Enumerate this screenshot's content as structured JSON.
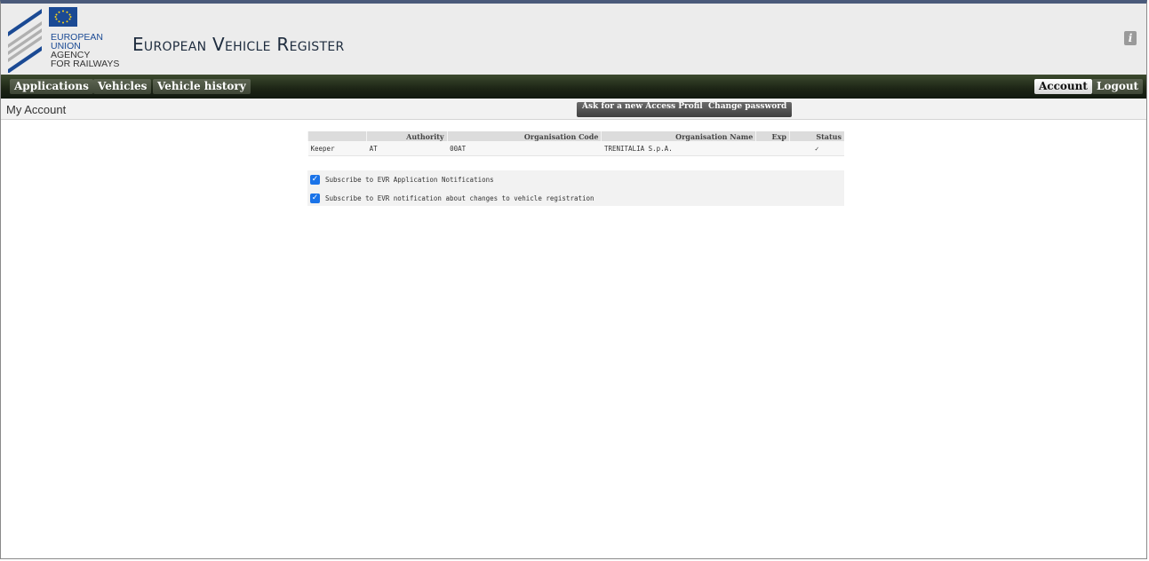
{
  "header": {
    "agency_lines": [
      "EUROPEAN",
      "UNION",
      "AGENCY",
      "FOR RAILWAYS"
    ],
    "app_title": "European Vehicle Register",
    "info_icon": "info-icon"
  },
  "nav": {
    "left": [
      "Applications",
      "Vehicles",
      "Vehicle history"
    ],
    "account": "Account",
    "logout": "Logout"
  },
  "page": {
    "title": "My Account",
    "ask_profile": "Ask for a new Access Profile",
    "change_password": "Change password"
  },
  "table": {
    "headers": [
      "",
      "Authority",
      "Organisation Code",
      "Organisation Name",
      "Exp",
      "Status"
    ],
    "rows": [
      [
        "Keeper",
        "AT",
        "00AT",
        "TRENITALIA S.p.A.",
        "",
        "✓"
      ]
    ]
  },
  "subscriptions": [
    {
      "label": "Subscribe to EVR Application Notifications",
      "checked": true
    },
    {
      "label": "Subscribe to EVR notification about changes to vehicle registration",
      "checked": true
    }
  ],
  "colors": {
    "accent": "#1b4a94",
    "navbar": "#1c2415",
    "checkbox": "#1a73e8"
  }
}
